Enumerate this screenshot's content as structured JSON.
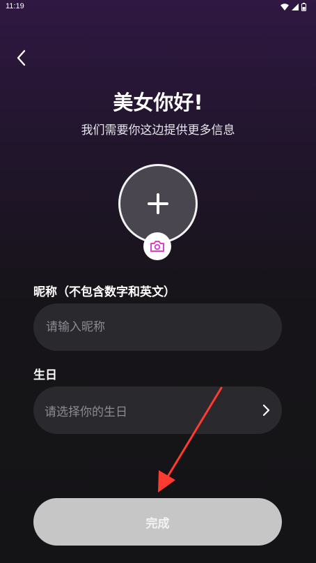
{
  "status_bar": {
    "time": "11:19",
    "icons": [
      "wifi-icon",
      "signal-icon",
      "battery-icon"
    ]
  },
  "header": {
    "back_icon": "chevron-left-icon",
    "title": "美女你好!",
    "subtitle": "我们需要你这边提供更多信息"
  },
  "avatar": {
    "icon": "plus-icon",
    "badge_icon": "camera-icon",
    "accent_color": "#e040c8"
  },
  "nickname": {
    "label": "昵称（不包含数字和英文）",
    "placeholder": "请输入昵称",
    "value": ""
  },
  "birthday": {
    "label": "生日",
    "placeholder": "请选择你的生日",
    "icon": "chevron-right-icon"
  },
  "submit": {
    "label": "完成",
    "color": "#c6c6c6"
  },
  "annotation": {
    "arrow_color": "#ff3b30"
  }
}
